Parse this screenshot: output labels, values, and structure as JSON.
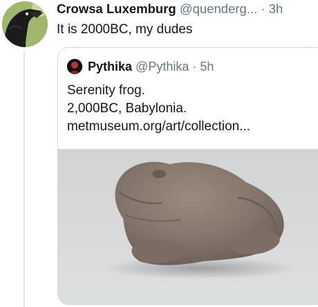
{
  "tweet": {
    "author_name": "Crowsa Luxemburg",
    "handle": "@quenderg...",
    "separator": "·",
    "time": "3h",
    "text": "It is 2000BC, my dudes"
  },
  "quoted_tweet": {
    "author_name": "Pythika",
    "handle": "@Pythika",
    "separator": "·",
    "time": "5h",
    "lines": [
      "Serenity frog.",
      "2,000BC, Babylonia.",
      "metmuseum.org/art/collection..."
    ]
  },
  "colors": {
    "text_primary": "#14171a",
    "text_secondary": "#657786",
    "border": "#cfd9de",
    "thread_line": "#e1e6ea"
  },
  "icons": {
    "avatar": "crow-avatar",
    "quoted_avatar": "pythika-avatar",
    "media": "stone-frog-photo"
  }
}
